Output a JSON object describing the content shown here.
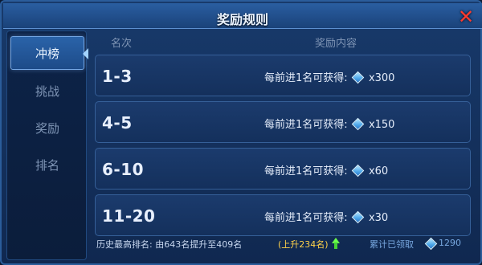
{
  "title": "奖励规则",
  "close_icon": "close-x-icon",
  "sidebar": {
    "tabs": [
      {
        "label": "冲榜",
        "active": true
      },
      {
        "label": "挑战",
        "active": false
      },
      {
        "label": "奖励",
        "active": false
      },
      {
        "label": "排名",
        "active": false
      }
    ]
  },
  "table": {
    "headers": {
      "rank": "名次",
      "reward": "奖励内容"
    },
    "rows": [
      {
        "rank": "1-3",
        "reward_text": "每前进1名可获得:",
        "amount": "x300"
      },
      {
        "rank": "4-5",
        "reward_text": "每前进1名可获得:",
        "amount": "x150"
      },
      {
        "rank": "6-10",
        "reward_text": "每前进1名可获得:",
        "amount": "x60"
      },
      {
        "rank": "11-20",
        "reward_text": "每前进1名可获得:",
        "amount": "x30"
      }
    ],
    "reward_icon": "diamond-gem-icon"
  },
  "footer": {
    "history_label": "历史最高排名: 由643名提升至409名",
    "rise_text": "(上升234名)",
    "accumulated_label": "累计已领取",
    "accumulated_value": "1290"
  },
  "colors": {
    "accent_blue": "#2a63a9",
    "gem_blue": "#4aa5e8",
    "rise_yellow": "#ffd24a",
    "rise_arrow_green": "#6bff4d",
    "close_red": "#ff3b2f"
  }
}
